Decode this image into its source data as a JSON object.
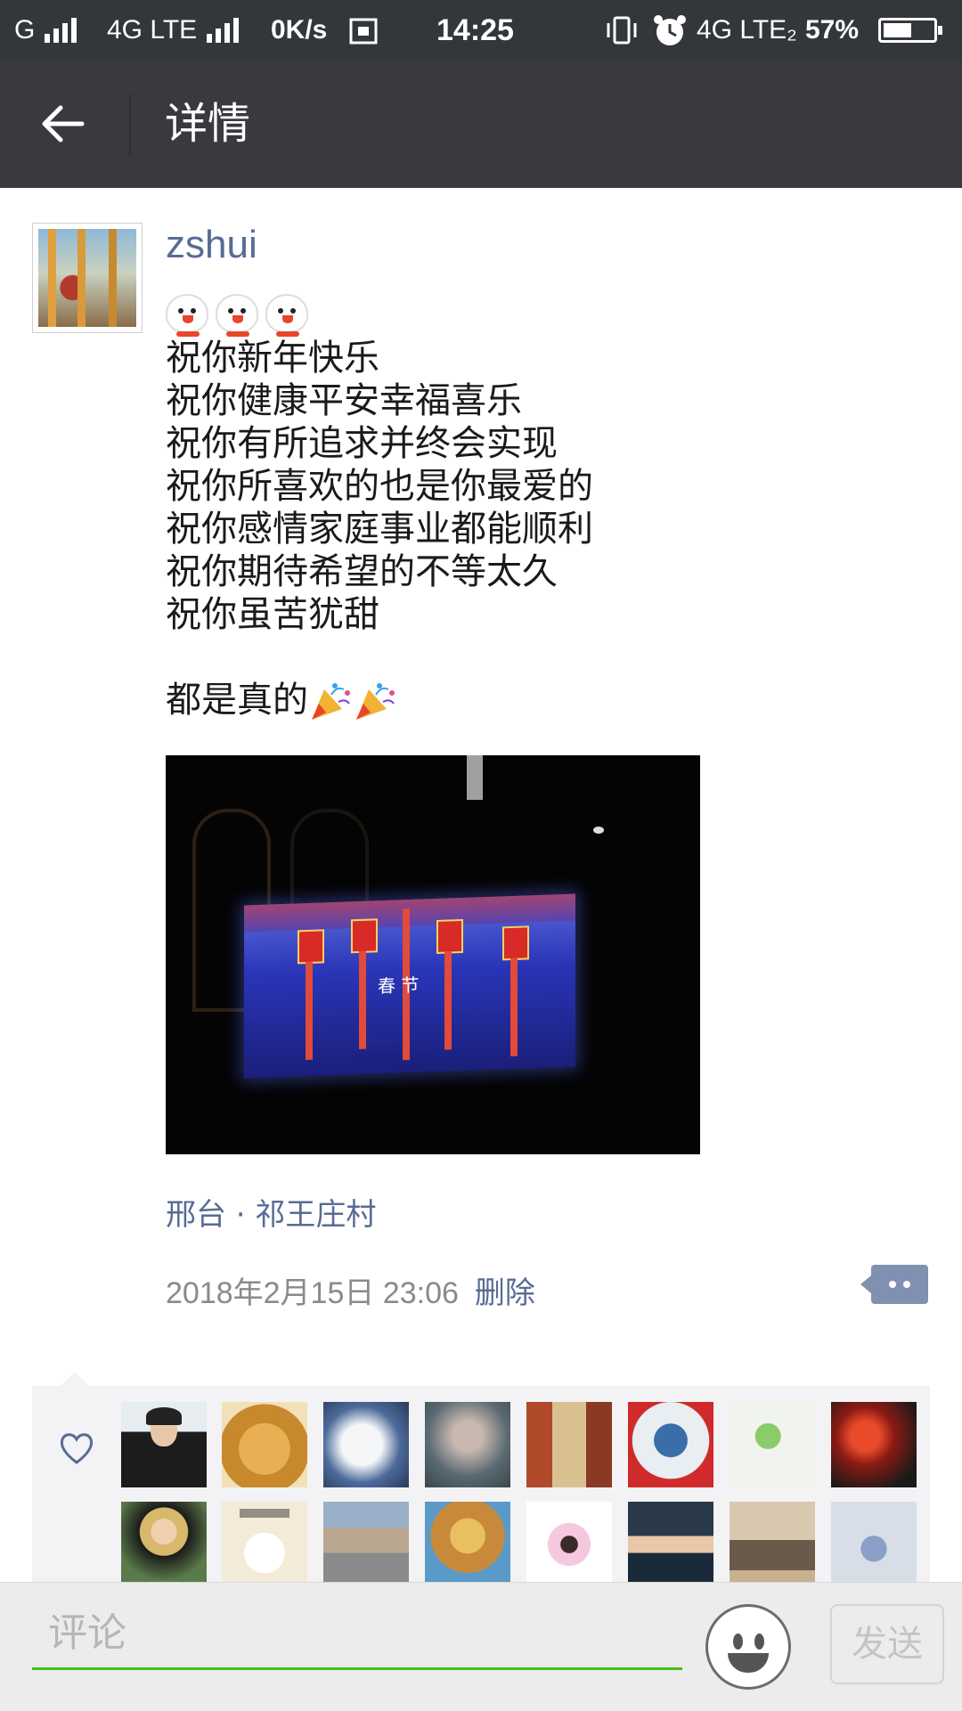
{
  "status_bar": {
    "carrier1": "G",
    "network2": "4G LTE",
    "speed": "0K/s",
    "time": "14:25",
    "network3": "4G LTE₂",
    "battery": "57%",
    "battery_level": 0.57
  },
  "header": {
    "title": "详情"
  },
  "post": {
    "username": "zshui",
    "lines": "祝你新年快乐\n祝你健康平安幸福喜乐\n祝你有所追求并终会实现\n祝你所喜欢的也是你最爱的\n祝你感情家庭事业都能顺利\n祝你期待希望的不等太久\n祝你虽苦犹甜\n\n",
    "last_line": "都是真的",
    "tv_sign": "春 节",
    "location": "邢台 · 祁王庄村",
    "timestamp": "2018年2月15日 23:06",
    "delete_label": "删除"
  },
  "comment_bar": {
    "placeholder": "评论",
    "send_label": "发送"
  },
  "colors": {
    "link": "#576b95",
    "title_bar": "#393a3f",
    "status_bar": "#33363b",
    "input_underline": "#45c01a"
  },
  "icons": [
    "back-arrow-icon",
    "heart-icon",
    "comment-dots-icon",
    "smiley-icon"
  ]
}
